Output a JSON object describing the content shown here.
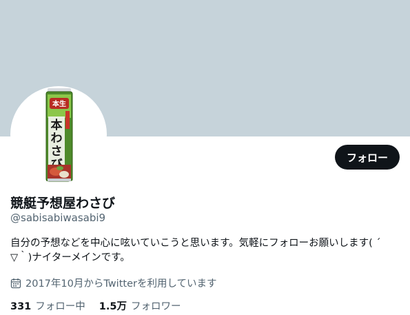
{
  "profile": {
    "display_name": "競艇予想屋わさび",
    "handle": "@sabisabiwasabi9",
    "bio_lines": [
      "自分の予想などを中心に呟いていこうと思います。気軽にフォローお願いします( ´",
      "▽｀)ナイターメインです。"
    ],
    "joined": "2017年10月からTwitterを利用しています",
    "following_count": "331",
    "following_label": "フォロー中",
    "followers_count": "1.5万",
    "followers_label": "フォロワー"
  },
  "actions": {
    "follow_label": "フォロー"
  },
  "avatar": {
    "package_text": "本わさび",
    "top_label": "本生"
  },
  "icons": {
    "joined_icon": "calendar-icon"
  },
  "colors": {
    "banner": "#c6d3da",
    "button_bg": "#0f1419",
    "secondary_text": "#536471"
  }
}
